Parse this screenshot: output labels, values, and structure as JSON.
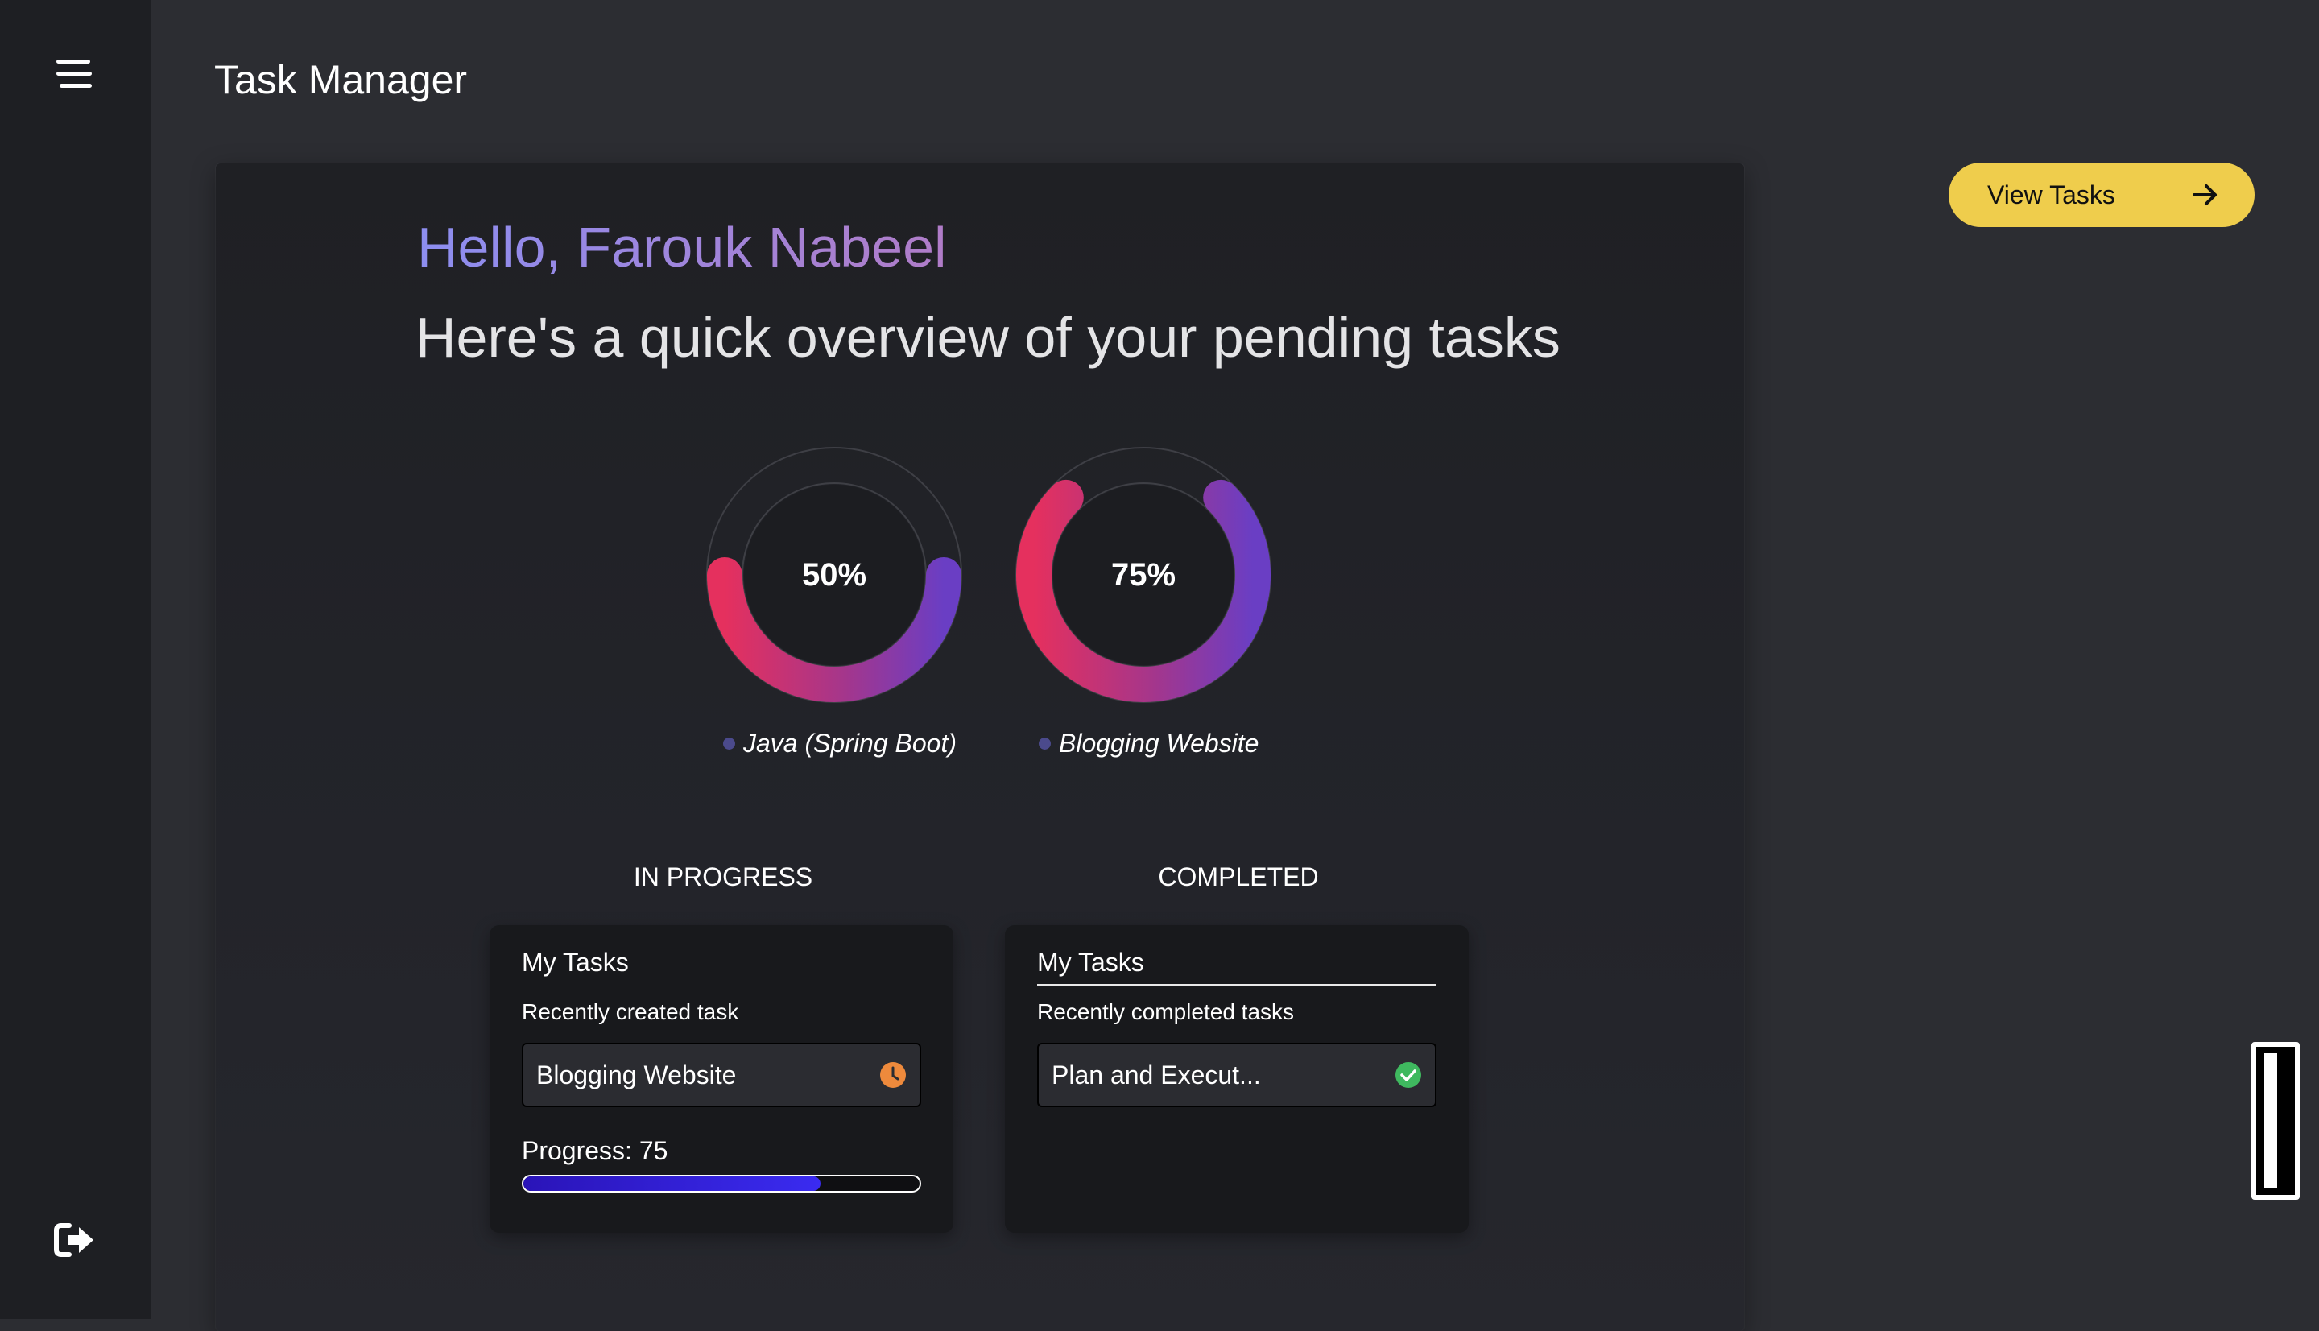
{
  "app": {
    "title": "Task Manager"
  },
  "sidebar": {
    "menu_icon": "hamburger-menu-icon",
    "logout_icon": "logout-icon"
  },
  "header": {
    "view_tasks_label": "View Tasks",
    "view_tasks_icon": "arrow-right-icon"
  },
  "overview": {
    "greeting": "Hello, Farouk Nabeel",
    "subtitle": "Here's a quick overview of your pending tasks",
    "projects": [
      {
        "name": "Java (Spring Boot)",
        "percent_label": "50%",
        "percent": 50
      },
      {
        "name": "Blogging Website",
        "percent_label": "75%",
        "percent": 75
      }
    ],
    "colors": {
      "ring_start": "#e5305e",
      "ring_mid": "#a4368c",
      "ring_end": "#6a3ec4",
      "track": "#3a3b40"
    }
  },
  "columns": {
    "in_progress": {
      "heading": "IN PROGRESS",
      "card_title": "My Tasks",
      "card_subtitle": "Recently created task",
      "task": "Blogging Website",
      "task_icon": "clock-icon",
      "progress_label": "Progress: 75",
      "progress": 75
    },
    "completed": {
      "heading": "COMPLETED",
      "card_title": "My Tasks",
      "card_subtitle": "Recently completed tasks",
      "task": "Plan and Execut...",
      "task_icon": "check-circle-icon"
    }
  },
  "accent_colors": {
    "button": "#efcd4c",
    "clock": "#ee8a3c",
    "check": "#3fb95f",
    "progress": "#3a2bf0"
  }
}
